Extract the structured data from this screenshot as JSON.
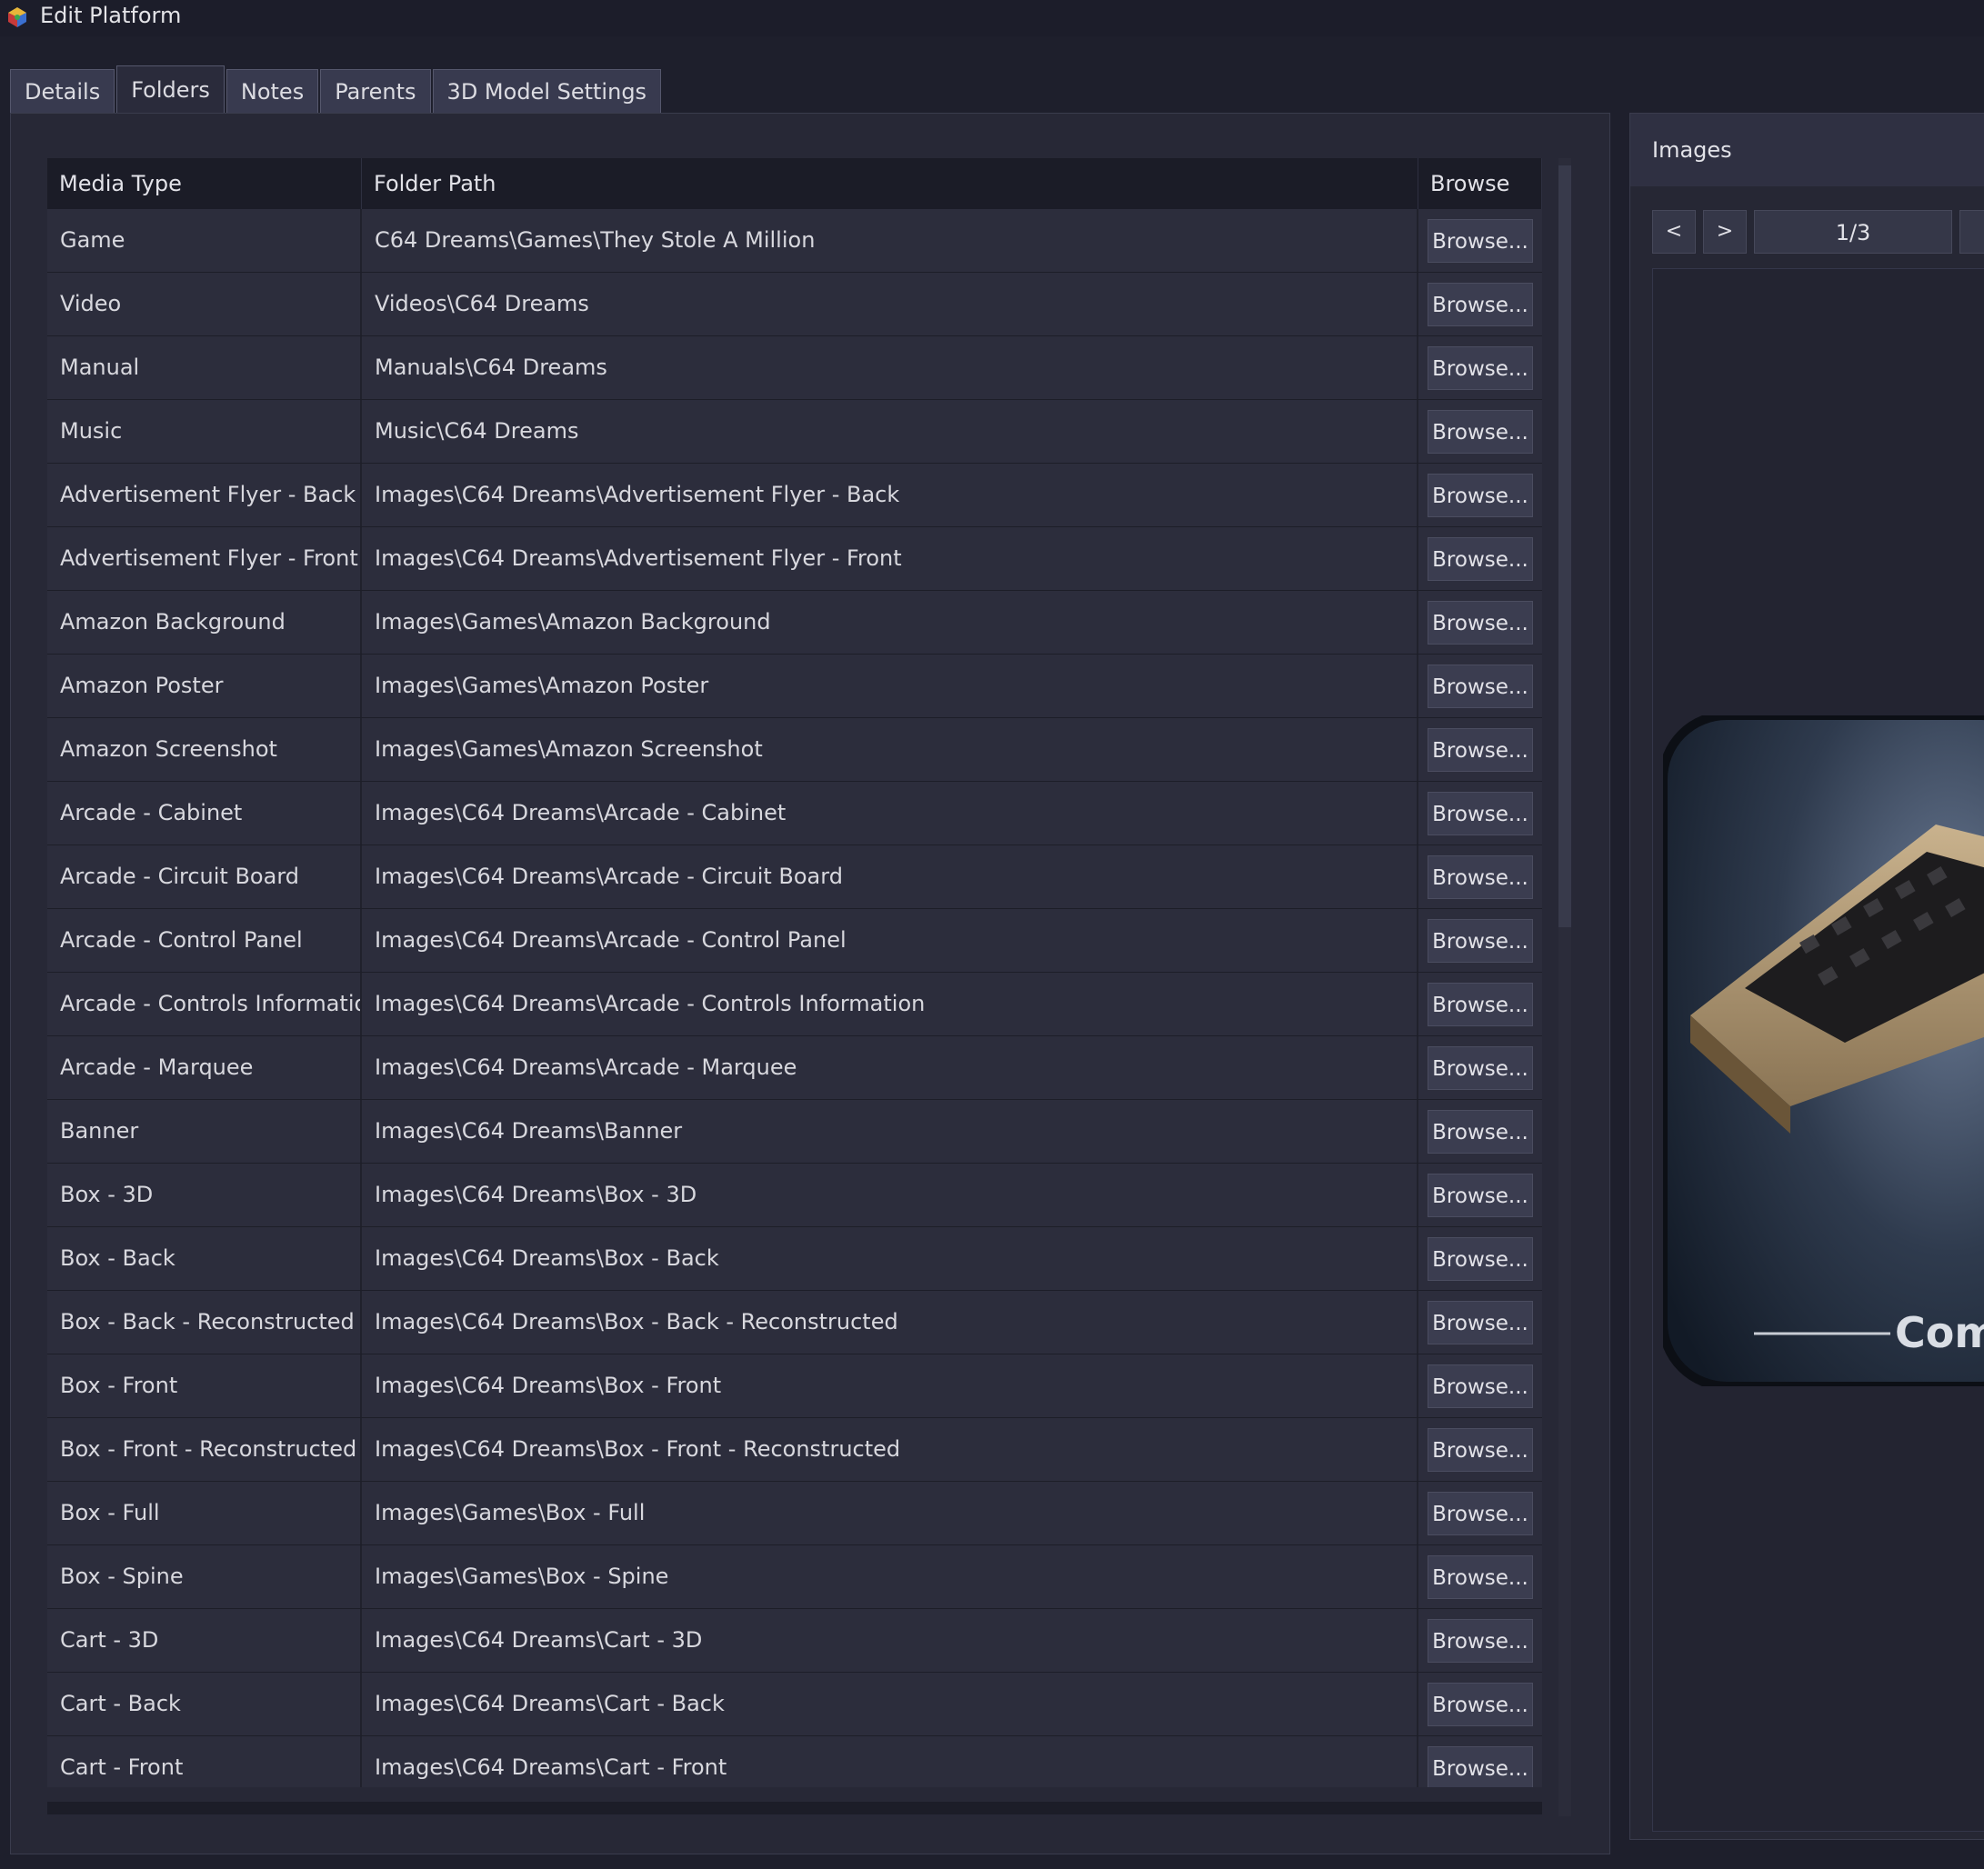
{
  "window": {
    "title": "Edit Platform"
  },
  "tabs": [
    {
      "label": "Details",
      "active": false
    },
    {
      "label": "Folders",
      "active": true
    },
    {
      "label": "Notes",
      "active": false
    },
    {
      "label": "Parents",
      "active": false
    },
    {
      "label": "3D Model Settings",
      "active": false
    }
  ],
  "grid": {
    "headers": {
      "media_type": "Media Type",
      "folder_path": "Folder Path",
      "browse": "Browse"
    },
    "browse_label": "Browse...",
    "rows": [
      {
        "media_type": "Game",
        "folder_path": "C64 Dreams\\Games\\They Stole A Million"
      },
      {
        "media_type": "Video",
        "folder_path": "Videos\\C64 Dreams"
      },
      {
        "media_type": "Manual",
        "folder_path": "Manuals\\C64 Dreams"
      },
      {
        "media_type": "Music",
        "folder_path": "Music\\C64 Dreams"
      },
      {
        "media_type": "Advertisement Flyer - Back",
        "folder_path": "Images\\C64 Dreams\\Advertisement Flyer - Back"
      },
      {
        "media_type": "Advertisement Flyer - Front",
        "folder_path": "Images\\C64 Dreams\\Advertisement Flyer - Front"
      },
      {
        "media_type": "Amazon Background",
        "folder_path": "Images\\Games\\Amazon Background"
      },
      {
        "media_type": "Amazon Poster",
        "folder_path": "Images\\Games\\Amazon Poster"
      },
      {
        "media_type": "Amazon Screenshot",
        "folder_path": "Images\\Games\\Amazon Screenshot"
      },
      {
        "media_type": "Arcade - Cabinet",
        "folder_path": "Images\\C64 Dreams\\Arcade - Cabinet"
      },
      {
        "media_type": "Arcade - Circuit Board",
        "folder_path": "Images\\C64 Dreams\\Arcade - Circuit Board"
      },
      {
        "media_type": "Arcade - Control Panel",
        "folder_path": "Images\\C64 Dreams\\Arcade - Control Panel"
      },
      {
        "media_type": "Arcade - Controls Information",
        "folder_path": "Images\\C64 Dreams\\Arcade - Controls Information"
      },
      {
        "media_type": "Arcade - Marquee",
        "folder_path": "Images\\C64 Dreams\\Arcade - Marquee"
      },
      {
        "media_type": "Banner",
        "folder_path": "Images\\C64 Dreams\\Banner"
      },
      {
        "media_type": "Box - 3D",
        "folder_path": "Images\\C64 Dreams\\Box - 3D"
      },
      {
        "media_type": "Box - Back",
        "folder_path": "Images\\C64 Dreams\\Box - Back"
      },
      {
        "media_type": "Box - Back - Reconstructed",
        "folder_path": "Images\\C64 Dreams\\Box - Back - Reconstructed"
      },
      {
        "media_type": "Box - Front",
        "folder_path": "Images\\C64 Dreams\\Box - Front"
      },
      {
        "media_type": "Box - Front - Reconstructed",
        "folder_path": "Images\\C64 Dreams\\Box - Front - Reconstructed"
      },
      {
        "media_type": "Box - Full",
        "folder_path": "Images\\Games\\Box - Full"
      },
      {
        "media_type": "Box - Spine",
        "folder_path": "Images\\Games\\Box - Spine"
      },
      {
        "media_type": "Cart - 3D",
        "folder_path": "Images\\C64 Dreams\\Cart - 3D"
      },
      {
        "media_type": "Cart - Back",
        "folder_path": "Images\\C64 Dreams\\Cart - Back"
      },
      {
        "media_type": "Cart - Front",
        "folder_path": "Images\\C64 Dreams\\Cart - Front"
      }
    ]
  },
  "images_panel": {
    "title": "Images",
    "prev_label": "<",
    "next_label": ">",
    "counter": "1/3",
    "preview_text": "Com"
  }
}
